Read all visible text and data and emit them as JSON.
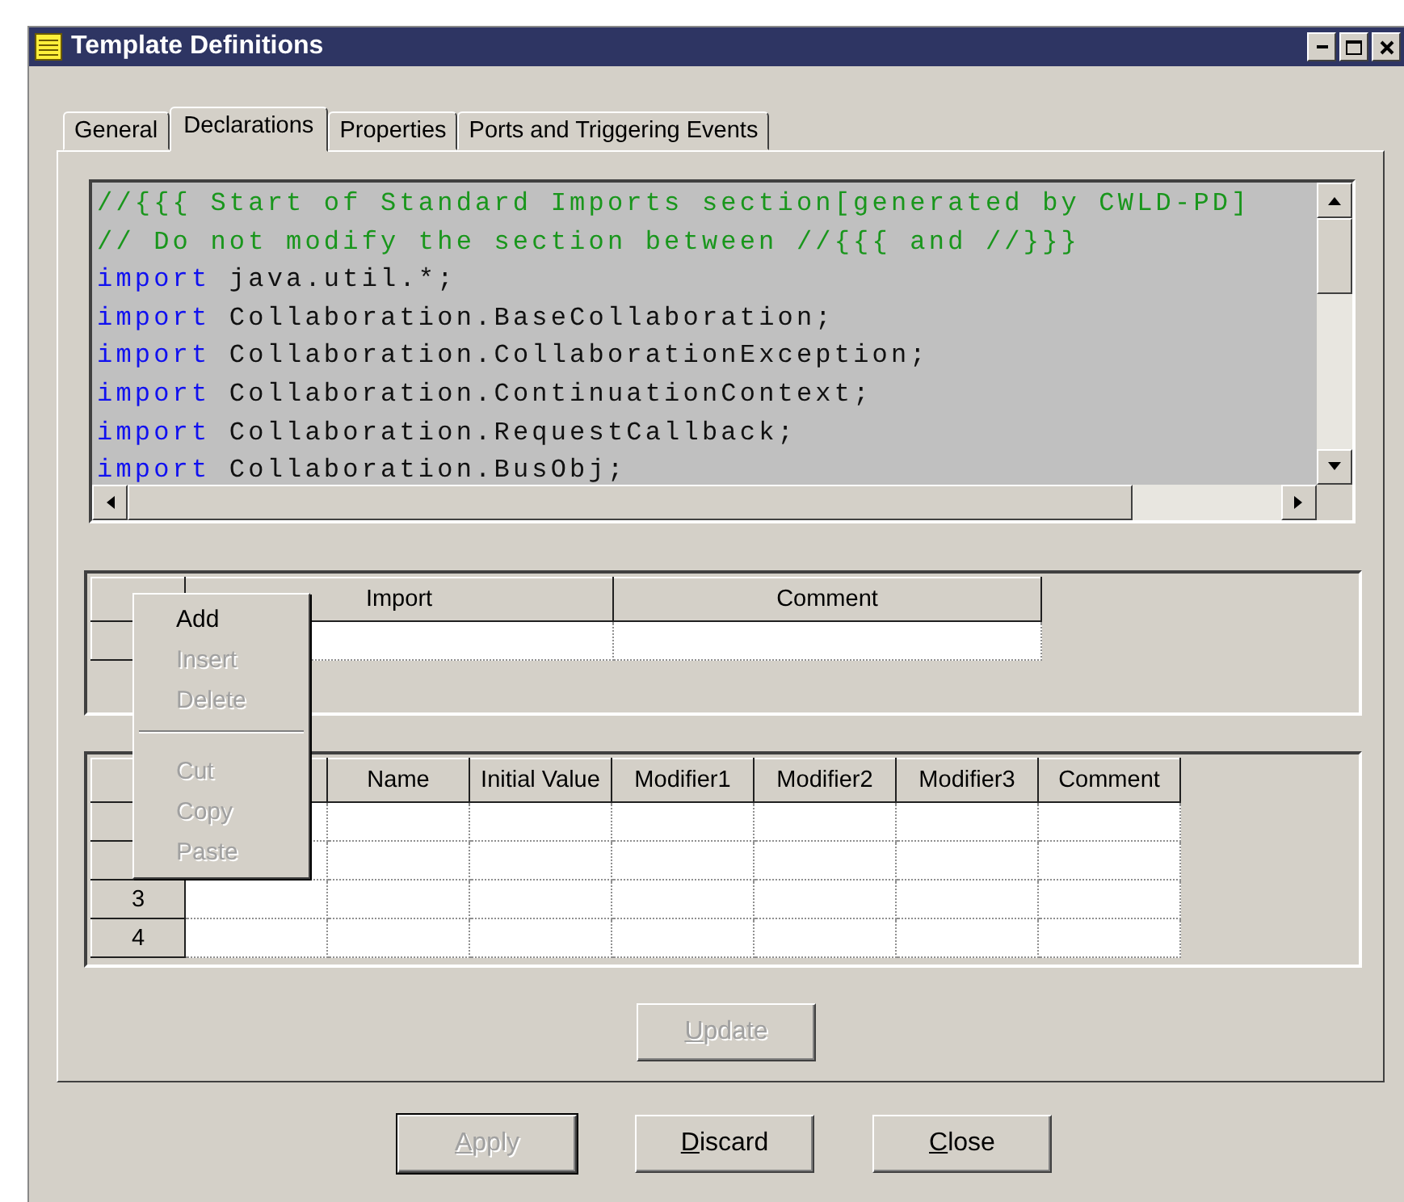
{
  "window": {
    "title": "Template Definitions"
  },
  "tabs": [
    {
      "label": "General",
      "selected": false
    },
    {
      "label": "Declarations",
      "selected": true
    },
    {
      "label": "Properties",
      "selected": false
    },
    {
      "label": "Ports and Triggering Events",
      "selected": false
    }
  ],
  "code_editor": {
    "lines": [
      {
        "kind": "comment",
        "text": "//{{{ Start of Standard Imports section[generated by CWLD-PD]"
      },
      {
        "kind": "comment",
        "text": "// Do not modify the section between //{{{ and //}}}"
      },
      {
        "kind": "code",
        "keyword": "import",
        "text": "java.util.*;"
      },
      {
        "kind": "code",
        "keyword": "import",
        "text": "Collaboration.BaseCollaboration;"
      },
      {
        "kind": "code",
        "keyword": "import",
        "text": "Collaboration.CollaborationException;"
      },
      {
        "kind": "code",
        "keyword": "import",
        "text": "Collaboration.ContinuationContext;"
      },
      {
        "kind": "code",
        "keyword": "import",
        "text": "Collaboration.RequestCallback;"
      },
      {
        "kind": "code",
        "keyword": "import",
        "text": "Collaboration.BusObj;"
      }
    ]
  },
  "imports_table": {
    "columns": [
      "Import",
      "Comment"
    ],
    "rows": [
      {}
    ]
  },
  "variables_table": {
    "columns": [
      "Name",
      "Initial Value",
      "Modifier1",
      "Modifier2",
      "Modifier3",
      "Comment"
    ],
    "rows": [
      {},
      {},
      {
        "header": "3"
      },
      {
        "header": "4"
      }
    ]
  },
  "context_menu": {
    "items": [
      {
        "kind": "item",
        "label": "Add",
        "disabled": false
      },
      {
        "kind": "item",
        "label": "Insert",
        "disabled": true
      },
      {
        "kind": "item",
        "label": "Delete",
        "disabled": true
      },
      {
        "kind": "separator"
      },
      {
        "kind": "item",
        "label": "Cut",
        "disabled": true
      },
      {
        "kind": "item",
        "label": "Copy",
        "disabled": true
      },
      {
        "kind": "item",
        "label": "Paste",
        "disabled": true
      }
    ]
  },
  "update_button": {
    "label": "Update",
    "disabled": true
  },
  "buttons": [
    {
      "label": "Apply",
      "disabled": true,
      "default": true
    },
    {
      "label": "Discard",
      "disabled": false,
      "default": false
    },
    {
      "label": "Close",
      "disabled": false,
      "default": false
    }
  ]
}
